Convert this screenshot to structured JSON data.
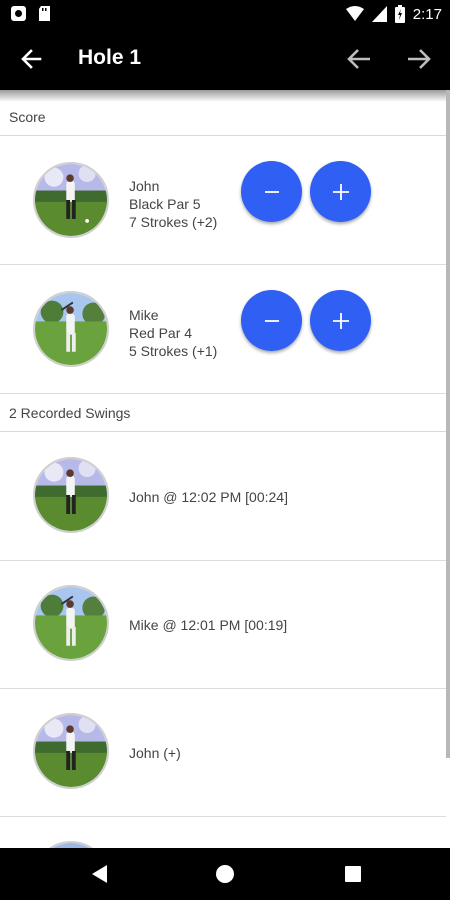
{
  "status_bar": {
    "time": "2:17"
  },
  "app_bar": {
    "title": "Hole 1"
  },
  "score_section": {
    "header": "Score"
  },
  "players": [
    {
      "name": "John",
      "tee_par": "Black Par 5",
      "strokes": "7 Strokes (+2)"
    },
    {
      "name": "Mike",
      "tee_par": "Red Par 4",
      "strokes": "5 Strokes (+1)"
    }
  ],
  "swings_section": {
    "header": "2 Recorded Swings"
  },
  "swings": [
    {
      "label": "John @ 12:02 PM [00:24]"
    },
    {
      "label": "Mike @ 12:01 PM [00:19]"
    },
    {
      "label": "John (+)"
    }
  ],
  "icons": {
    "back": "arrow-back-icon",
    "prev": "arrow-left-icon",
    "next": "arrow-right-icon",
    "minus": "minus-icon",
    "plus": "plus-icon"
  },
  "colors": {
    "accent": "#2f5ff3",
    "app_bar": "#000000"
  }
}
